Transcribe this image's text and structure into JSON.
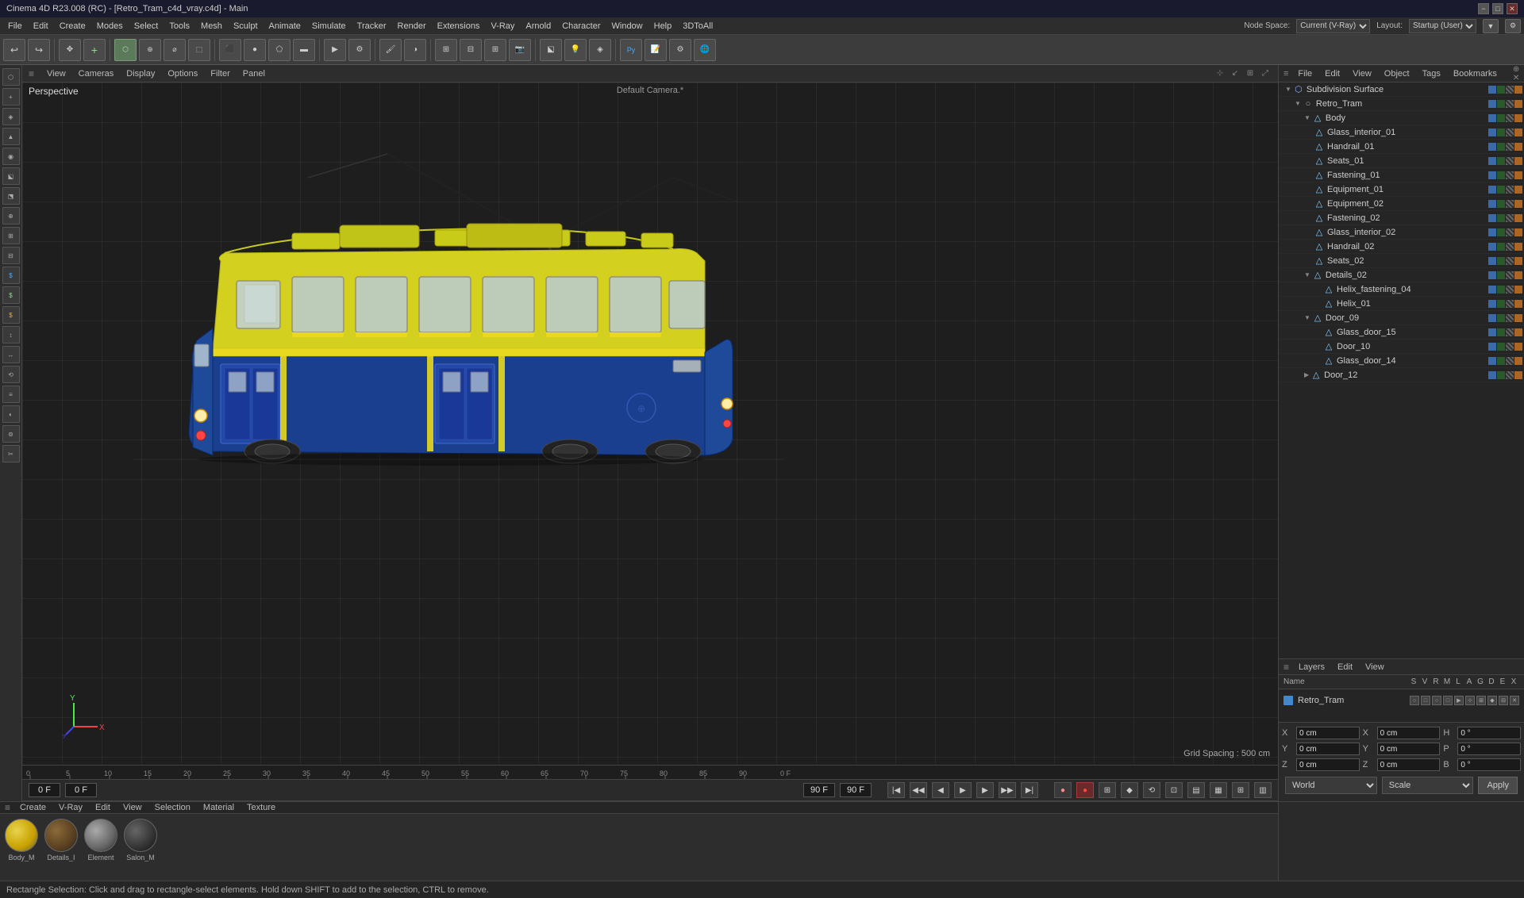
{
  "titlebar": {
    "title": "Cinema 4D R23.008 (RC) - [Retro_Tram_c4d_vray.c4d] - Main",
    "min": "−",
    "max": "□",
    "close": "✕"
  },
  "menubar": {
    "items": [
      "File",
      "Edit",
      "Create",
      "Modes",
      "Select",
      "Tools",
      "Mesh",
      "Sculpt",
      "Animate",
      "Simulate",
      "Tracker",
      "Render",
      "Extensions",
      "V-Ray",
      "Arnold",
      "Character",
      "Window",
      "Help",
      "3DToAll"
    ]
  },
  "toolbar": {
    "groups": [
      "undo",
      "modes",
      "primitives",
      "splines",
      "nurbs",
      "deformers",
      "cameras",
      "lights",
      "materials",
      "render",
      "viewport"
    ]
  },
  "viewport": {
    "perspective_label": "Perspective",
    "camera_label": "Default Camera.*",
    "grid_spacing": "Grid Spacing : 500 cm",
    "header_menus": [
      "View",
      "Cameras",
      "Display",
      "Options",
      "Filter",
      "Panel"
    ]
  },
  "obj_manager": {
    "header_tabs": [
      "File",
      "Edit",
      "View",
      "Object",
      "Tags",
      "Bookmarks"
    ],
    "items": [
      {
        "name": "Subdivision Surface",
        "level": 0,
        "icon": "subd",
        "selected": false
      },
      {
        "name": "Retro_Tram",
        "level": 1,
        "icon": "null",
        "selected": false
      },
      {
        "name": "Body",
        "level": 2,
        "icon": "poly",
        "selected": false
      },
      {
        "name": "Glass_interior_01",
        "level": 3,
        "icon": "poly",
        "selected": false
      },
      {
        "name": "Handrail_01",
        "level": 3,
        "icon": "poly",
        "selected": false
      },
      {
        "name": "Seats_01",
        "level": 3,
        "icon": "poly",
        "selected": false
      },
      {
        "name": "Fastening_01",
        "level": 3,
        "icon": "poly",
        "selected": false
      },
      {
        "name": "Equipment_01",
        "level": 3,
        "icon": "poly",
        "selected": false
      },
      {
        "name": "Equipment_02",
        "level": 3,
        "icon": "poly",
        "selected": false
      },
      {
        "name": "Fastening_02",
        "level": 3,
        "icon": "poly",
        "selected": false
      },
      {
        "name": "Glass_interior_02",
        "level": 3,
        "icon": "poly",
        "selected": false
      },
      {
        "name": "Handrail_02",
        "level": 3,
        "icon": "poly",
        "selected": false
      },
      {
        "name": "Seats_02",
        "level": 3,
        "icon": "poly",
        "selected": false
      },
      {
        "name": "Details_02",
        "level": 3,
        "icon": "poly",
        "selected": false
      },
      {
        "name": "Helix_fastening_04",
        "level": 4,
        "icon": "poly",
        "selected": false
      },
      {
        "name": "Helix_01",
        "level": 4,
        "icon": "poly",
        "selected": false
      },
      {
        "name": "Door_09",
        "level": 3,
        "icon": "poly",
        "selected": false
      },
      {
        "name": "Glass_door_15",
        "level": 4,
        "icon": "poly",
        "selected": false
      },
      {
        "name": "Door_10",
        "level": 4,
        "icon": "poly",
        "selected": false
      },
      {
        "name": "Glass_door_14",
        "level": 4,
        "icon": "poly",
        "selected": false
      },
      {
        "name": "Door_12",
        "level": 3,
        "icon": "poly",
        "selected": false
      }
    ]
  },
  "layers_panel": {
    "header_tabs": [
      "Layers",
      "Edit",
      "View"
    ],
    "col_headers": [
      "N",
      "S",
      "V",
      "R",
      "M",
      "L",
      "A",
      "G",
      "D",
      "E",
      "X"
    ],
    "layer_name": "Retro_Tram"
  },
  "timeline": {
    "header_tabs": [
      "Create",
      "V-Ray",
      "Edit",
      "View",
      "Selection",
      "Material",
      "Texture"
    ],
    "frame_start": "0 F",
    "frame_current": "0 F",
    "frame_end": "90 F",
    "frame_total": "90 F",
    "ruler_marks": [
      0,
      5,
      10,
      15,
      20,
      25,
      30,
      35,
      40,
      45,
      50,
      55,
      60,
      65,
      70,
      75,
      80,
      85,
      90
    ],
    "right_label": "0 F"
  },
  "materials": [
    {
      "name": "Body_M",
      "type": "yellow-blue"
    },
    {
      "name": "Details_I",
      "type": "brown"
    },
    {
      "name": "Element",
      "type": "gray"
    },
    {
      "name": "Salon_M",
      "type": "dark"
    }
  ],
  "transform": {
    "x_pos": "0 cm",
    "y_pos": "0 cm",
    "z_pos": "0 cm",
    "h": "0 °",
    "p": "0 °",
    "b": "0 °",
    "x_scale": "0 cm",
    "y_scale": "0 cm",
    "z_scale": "0 cm",
    "coord_system": "World",
    "coord_mode": "Scale",
    "apply_label": "Apply"
  },
  "statusbar": {
    "message": "Rectangle Selection: Click and drag to rectangle-select elements. Hold down SHIFT to add to the selection, CTRL to remove."
  },
  "node_space": {
    "label": "Node Space:",
    "value": "Current (V-Ray)"
  },
  "layout": {
    "label": "Layout:",
    "value": "Startup (User)"
  }
}
